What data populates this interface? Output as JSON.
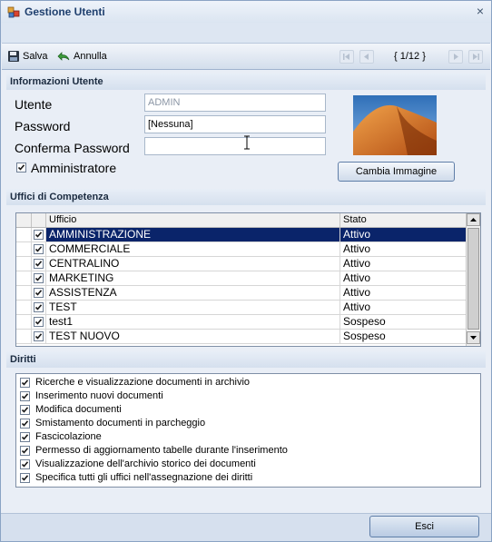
{
  "window": {
    "title": "Gestione Utenti",
    "close_glyph": "×"
  },
  "toolbar": {
    "save_label": "Salva",
    "cancel_label": "Annulla",
    "record_counter": "{ 1/12 }"
  },
  "info": {
    "section_title": "Informazioni Utente",
    "user_label": "Utente",
    "user_value": "ADMIN",
    "password_label": "Password",
    "password_value": "[Nessuna]",
    "confirm_label": "Conferma Password",
    "confirm_value": "",
    "admin_label": "Amministratore",
    "admin_checked": true,
    "change_image_label": "Cambia Immagine"
  },
  "offices": {
    "section_title": "Uffici di Competenza",
    "columns": [
      "Ufficio",
      "Stato"
    ],
    "rows": [
      {
        "name": "AMMINISTRAZIONE",
        "status": "Attivo",
        "checked": true,
        "selected": true
      },
      {
        "name": "COMMERCIALE",
        "status": "Attivo",
        "checked": true
      },
      {
        "name": "CENTRALINO",
        "status": "Attivo",
        "checked": true
      },
      {
        "name": "MARKETING",
        "status": "Attivo",
        "checked": true
      },
      {
        "name": "ASSISTENZA",
        "status": "Attivo",
        "checked": true
      },
      {
        "name": "TEST",
        "status": "Attivo",
        "checked": true
      },
      {
        "name": "test1",
        "status": "Sospeso",
        "checked": true
      },
      {
        "name": "TEST NUOVO",
        "status": "Sospeso",
        "checked": true
      }
    ]
  },
  "rights": {
    "section_title": "Diritti",
    "items": [
      "Ricerche e visualizzazione documenti in archivio",
      "Inserimento nuovi documenti",
      "Modifica documenti",
      "Smistamento documenti in parcheggio",
      "Fascicolazione",
      "Permesso di aggiornamento tabelle durante l'inserimento",
      "Visualizzazione dell'archivio storico dei documenti",
      "Specifica tutti gli uffici nell'assegnazione dei diritti"
    ]
  },
  "footer": {
    "exit_label": "Esci"
  },
  "colors": {
    "accent": "#0a246a",
    "section": "#d5e0ee",
    "window_bg": "#e9eef6"
  }
}
